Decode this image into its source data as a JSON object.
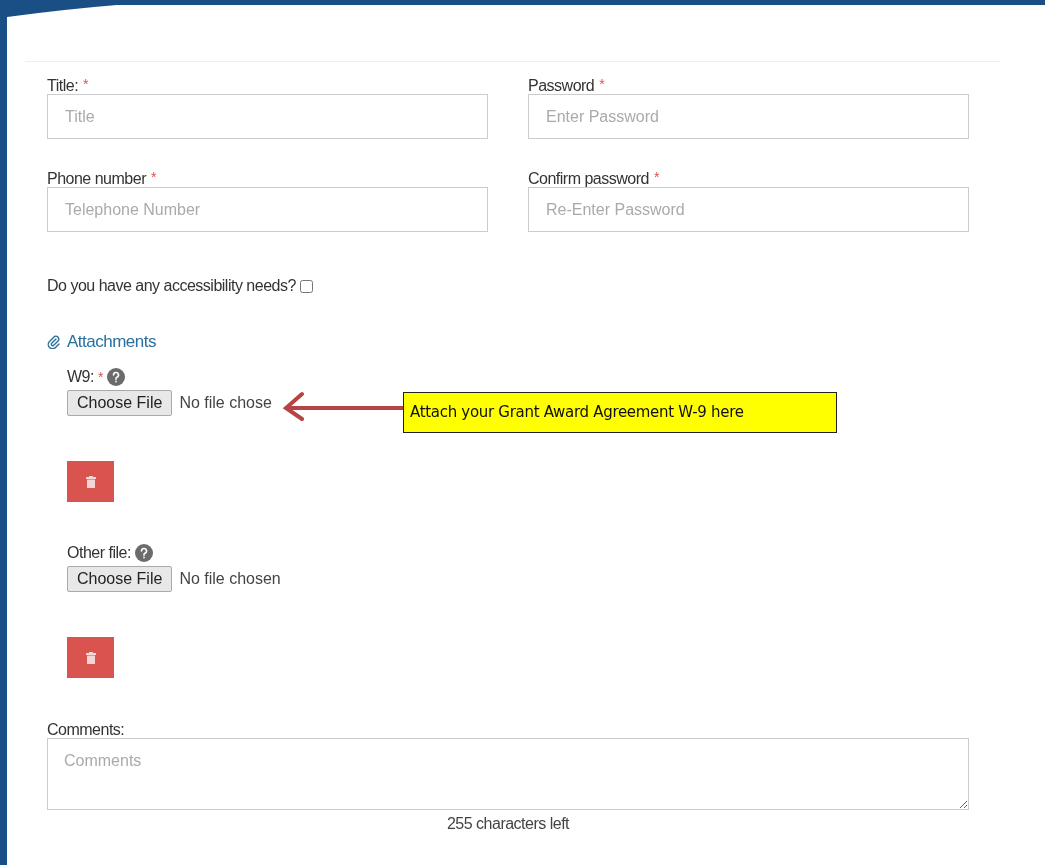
{
  "fields": [
    {
      "label": "Title:",
      "required_mark": "*",
      "placeholder": "Title"
    },
    {
      "label": "Password",
      "required_mark": "*",
      "placeholder": "Enter Password"
    },
    {
      "label": "Phone number",
      "required_mark": "*",
      "placeholder": "Telephone Number"
    },
    {
      "label": "Confirm password",
      "required_mark": "*",
      "placeholder": "Re-Enter Password"
    }
  ],
  "accessibility": {
    "label": "Do you have any accessibility needs?",
    "checked": false
  },
  "attachments": {
    "heading": "Attachments",
    "files": [
      {
        "label": "W9:",
        "required_mark": "*",
        "button": "Choose File",
        "status": "No file chose"
      },
      {
        "label": "Other file:",
        "button": "Choose File",
        "status": "No file chosen"
      }
    ]
  },
  "comments": {
    "label": "Comments:",
    "placeholder": "Comments",
    "counter": "255 characters left"
  },
  "callout": {
    "text": "Attach your Grant Award Agreement W-9 here"
  }
}
